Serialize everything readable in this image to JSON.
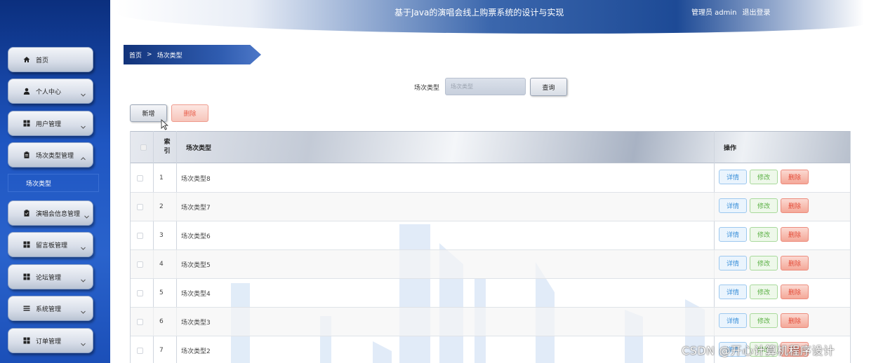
{
  "header": {
    "title": "基于Java的演唱会线上购票系统的设计与实现",
    "user_role": "管理员 admin",
    "logout": "退出登录"
  },
  "sidebar": {
    "items": [
      {
        "label": "首页",
        "icon": "home-icon",
        "has_chevron": false,
        "expanded": false
      },
      {
        "label": "个人中心",
        "icon": "user-icon",
        "has_chevron": true,
        "expanded": false
      },
      {
        "label": "用户管理",
        "icon": "grid-icon",
        "has_chevron": true,
        "expanded": false
      },
      {
        "label": "场次类型管理",
        "icon": "clipboard-icon",
        "has_chevron": true,
        "expanded": true
      },
      {
        "label": "演唱会信息管理",
        "icon": "clipboard-icon",
        "has_chevron": true,
        "expanded": false
      },
      {
        "label": "留言板管理",
        "icon": "grid-icon",
        "has_chevron": true,
        "expanded": false
      },
      {
        "label": "论坛管理",
        "icon": "grid-icon",
        "has_chevron": true,
        "expanded": false
      },
      {
        "label": "系统管理",
        "icon": "list-icon",
        "has_chevron": true,
        "expanded": false
      },
      {
        "label": "订单管理",
        "icon": "grid-icon",
        "has_chevron": true,
        "expanded": false
      }
    ],
    "submenu": {
      "label": "场次类型"
    }
  },
  "breadcrumb": {
    "home": "首页",
    "separator": ">",
    "current": "场次类型"
  },
  "search": {
    "label": "场次类型",
    "placeholder": "场次类型",
    "button": "查询"
  },
  "toolbar": {
    "add": "新增",
    "delete": "删除"
  },
  "table": {
    "headers": {
      "index": "索引",
      "type": "场次类型",
      "actions": "操作"
    },
    "rows": [
      {
        "index": "1",
        "type": "场次类型8"
      },
      {
        "index": "2",
        "type": "场次类型7"
      },
      {
        "index": "3",
        "type": "场次类型6"
      },
      {
        "index": "4",
        "type": "场次类型5"
      },
      {
        "index": "5",
        "type": "场次类型4"
      },
      {
        "index": "6",
        "type": "场次类型3"
      },
      {
        "index": "7",
        "type": "场次类型2"
      }
    ],
    "actions": {
      "detail": "详情",
      "edit": "修改",
      "delete": "删除"
    }
  },
  "watermark": "CSDN @开心计算机程序设计",
  "colors": {
    "sidebar": "#1f56c2",
    "header_dark": "#1d4a96",
    "danger": "#e34a36",
    "info": "#3b8fd9",
    "success": "#5bb045"
  }
}
